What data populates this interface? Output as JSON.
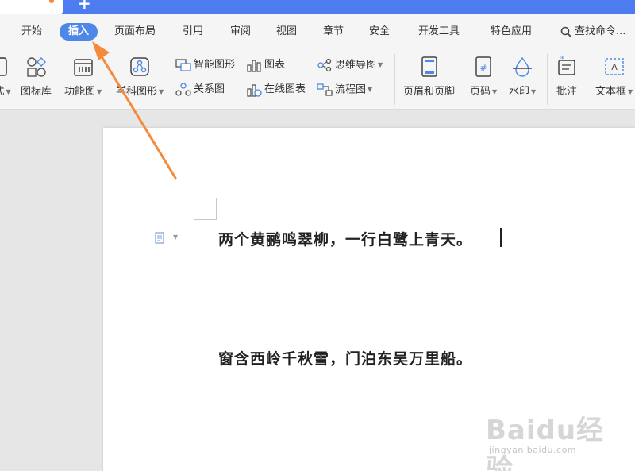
{
  "titlebar": {
    "new_tab_glyph": "+"
  },
  "menu": {
    "items": [
      {
        "label": "开始"
      },
      {
        "label": "插入"
      },
      {
        "label": "页面布局"
      },
      {
        "label": "引用"
      },
      {
        "label": "审阅"
      },
      {
        "label": "视图"
      },
      {
        "label": "章节"
      },
      {
        "label": "安全"
      },
      {
        "label": "开发工具"
      },
      {
        "label": "特色应用"
      }
    ],
    "active_index": 1,
    "search_label": "查找命令..."
  },
  "ribbon": {
    "partial_left_label": "式",
    "icon_library": "图标库",
    "function_chart": "功能图",
    "subject_shape": "学科图形",
    "smart_shape": "智能图形",
    "relation_chart": "关系图",
    "chart": "图表",
    "online_chart": "在线图表",
    "mind_map": "思维导图",
    "flow_chart": "流程图",
    "header_footer": "页眉和页脚",
    "page_number": "页码",
    "watermark": "水印",
    "comment": "批注",
    "text_box": "文本框"
  },
  "document": {
    "line1": "两个黄鹂鸣翠柳，一行白鹭上青天。",
    "line2": "窗含西岭千秋雪，门泊东吴万里船。"
  },
  "watermark_text": {
    "logo": "Baidu经验",
    "url": "jingyan.baidu.com"
  },
  "colors": {
    "accent": "#4d87e8",
    "titlebar": "#4d7cf0",
    "arrow": "#f58a3b"
  }
}
